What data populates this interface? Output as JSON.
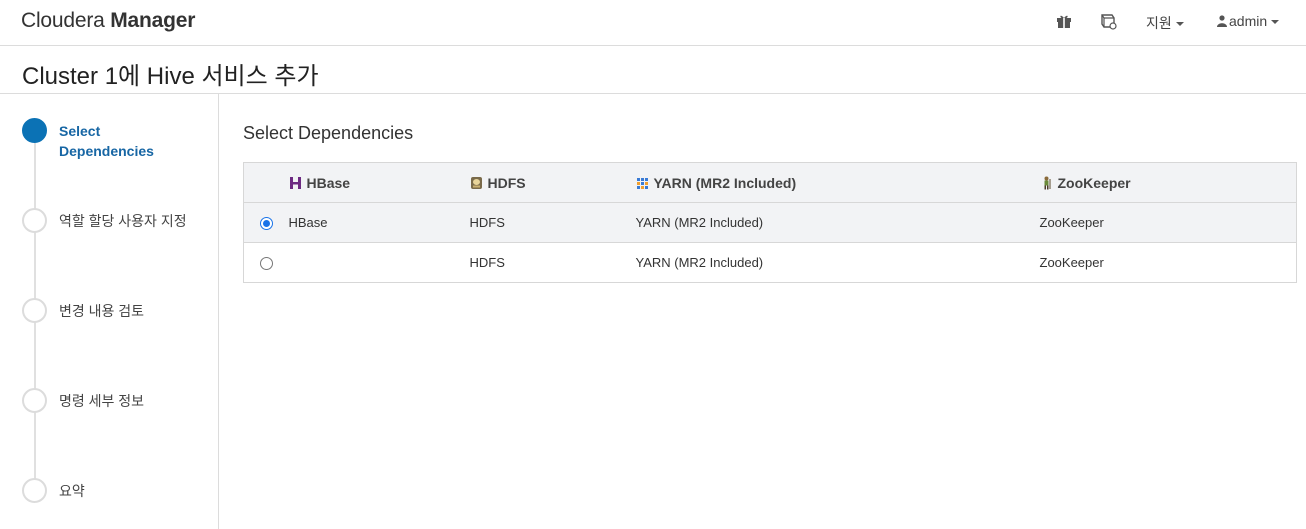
{
  "header": {
    "brand_light": "Cloudera",
    "brand_bold": "Manager",
    "support_label": "지원",
    "user_label": "admin"
  },
  "page": {
    "title": "Cluster 1에 Hive 서비스 추가"
  },
  "wizard": {
    "steps": [
      {
        "label": "Select Dependencies",
        "active": true
      },
      {
        "label": "역할 할당 사용자 지정",
        "active": false
      },
      {
        "label": "변경 내용 검토",
        "active": false
      },
      {
        "label": "명령 세부 정보",
        "active": false
      },
      {
        "label": "요약",
        "active": false
      }
    ]
  },
  "main": {
    "section_title": "Select Dependencies",
    "columns": [
      "HBase",
      "HDFS",
      "YARN (MR2 Included)",
      "ZooKeeper"
    ],
    "rows": [
      {
        "selected": true,
        "hbase": "HBase",
        "hdfs": "HDFS",
        "yarn": "YARN (MR2 Included)",
        "zookeeper": "ZooKeeper"
      },
      {
        "selected": false,
        "hbase": "",
        "hdfs": "HDFS",
        "yarn": "YARN (MR2 Included)",
        "zookeeper": "ZooKeeper"
      }
    ]
  },
  "colors": {
    "accent": "#0b72b5",
    "active_step_text": "#1766a4",
    "hbase_icon": "#6d2b82"
  },
  "icons": {
    "gift": "gift-icon",
    "parcel": "parcel-icon",
    "hbase": "hbase-icon",
    "hdfs": "hdfs-icon",
    "yarn": "yarn-icon",
    "zookeeper": "zookeeper-icon",
    "user": "user-icon"
  }
}
